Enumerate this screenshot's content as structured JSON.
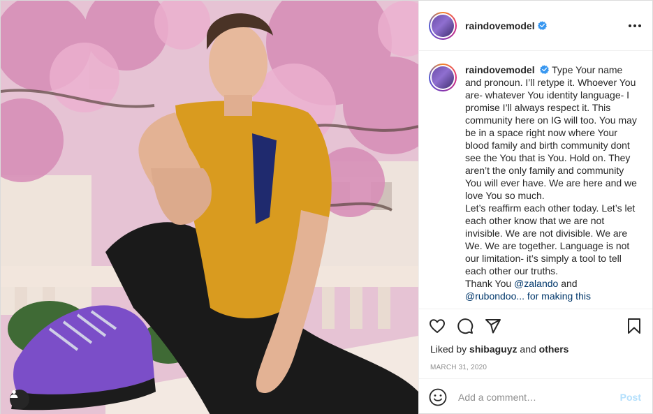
{
  "post": {
    "username": "raindovemodel",
    "verified": true,
    "more_icon": "more-horizontal-icon"
  },
  "caption": {
    "username": "raindovemodel",
    "paragraphs": [
      "Type Your name and pronoun. I’ll retype it. Whoever You are- whatever You identity language- I promise I’ll always respect it. This community here on IG will too. You may be in a space right now where Your blood family and birth community dont see the You that is You. Hold on. They aren’t the only family and community You will ever have. We are here and we love You so much.",
      "Let’s reaffirm each other today. Let’s let each other know that we are not invisible. We are not divisible. We are We. We are together. Language is not our limitation- it’s simply a tool to tell each other our truths."
    ],
    "thanks_prefix": "Thank You",
    "mention_1": "@zalando",
    "thanks_and": "and",
    "mention_2_partial": "@rubondoo... for making this"
  },
  "actions": {
    "like_icon": "heart-icon",
    "comment_icon": "comment-icon",
    "share_icon": "share-icon",
    "save_icon": "bookmark-icon"
  },
  "likes": {
    "prefix": "Liked by",
    "user": "shibaguyz",
    "joiner": "and",
    "others": "others"
  },
  "date": "MARCH 31, 2020",
  "comment": {
    "placeholder": "Add a comment…",
    "post_label": "Post",
    "emoji_icon": "smiley-icon"
  },
  "photo": {
    "tag_icon": "user-tag-icon"
  },
  "colors": {
    "accent": "#0095f6",
    "post_disabled": "#b2dffc",
    "mention": "#00376b",
    "verified": "#3897f0"
  }
}
